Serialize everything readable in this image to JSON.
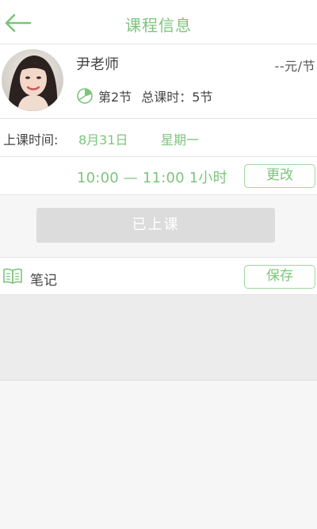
{
  "header": {
    "title": "课程信息",
    "back_icon": "back-arrow-icon"
  },
  "teacher": {
    "name": "尹老师",
    "price": "--元/节",
    "lesson_number": "第2节",
    "total_label": "总课时：",
    "total_value": "5节",
    "lesson_icon": "pie-chart-icon"
  },
  "schedule": {
    "label": "上课时间:",
    "date": "8月31日",
    "weekday": "星期一",
    "time_range": "10:00 — 11:00  1小时",
    "change_label": "更改"
  },
  "status_button": {
    "label": "已上课"
  },
  "notes": {
    "label": "笔记",
    "save_label": "保存",
    "icon": "notebook-icon"
  },
  "colors": {
    "accent": "#7cc57c",
    "accent_border": "#9fd69f",
    "disabled_button": "#dcdcdc",
    "background": "#f6f6f6"
  }
}
